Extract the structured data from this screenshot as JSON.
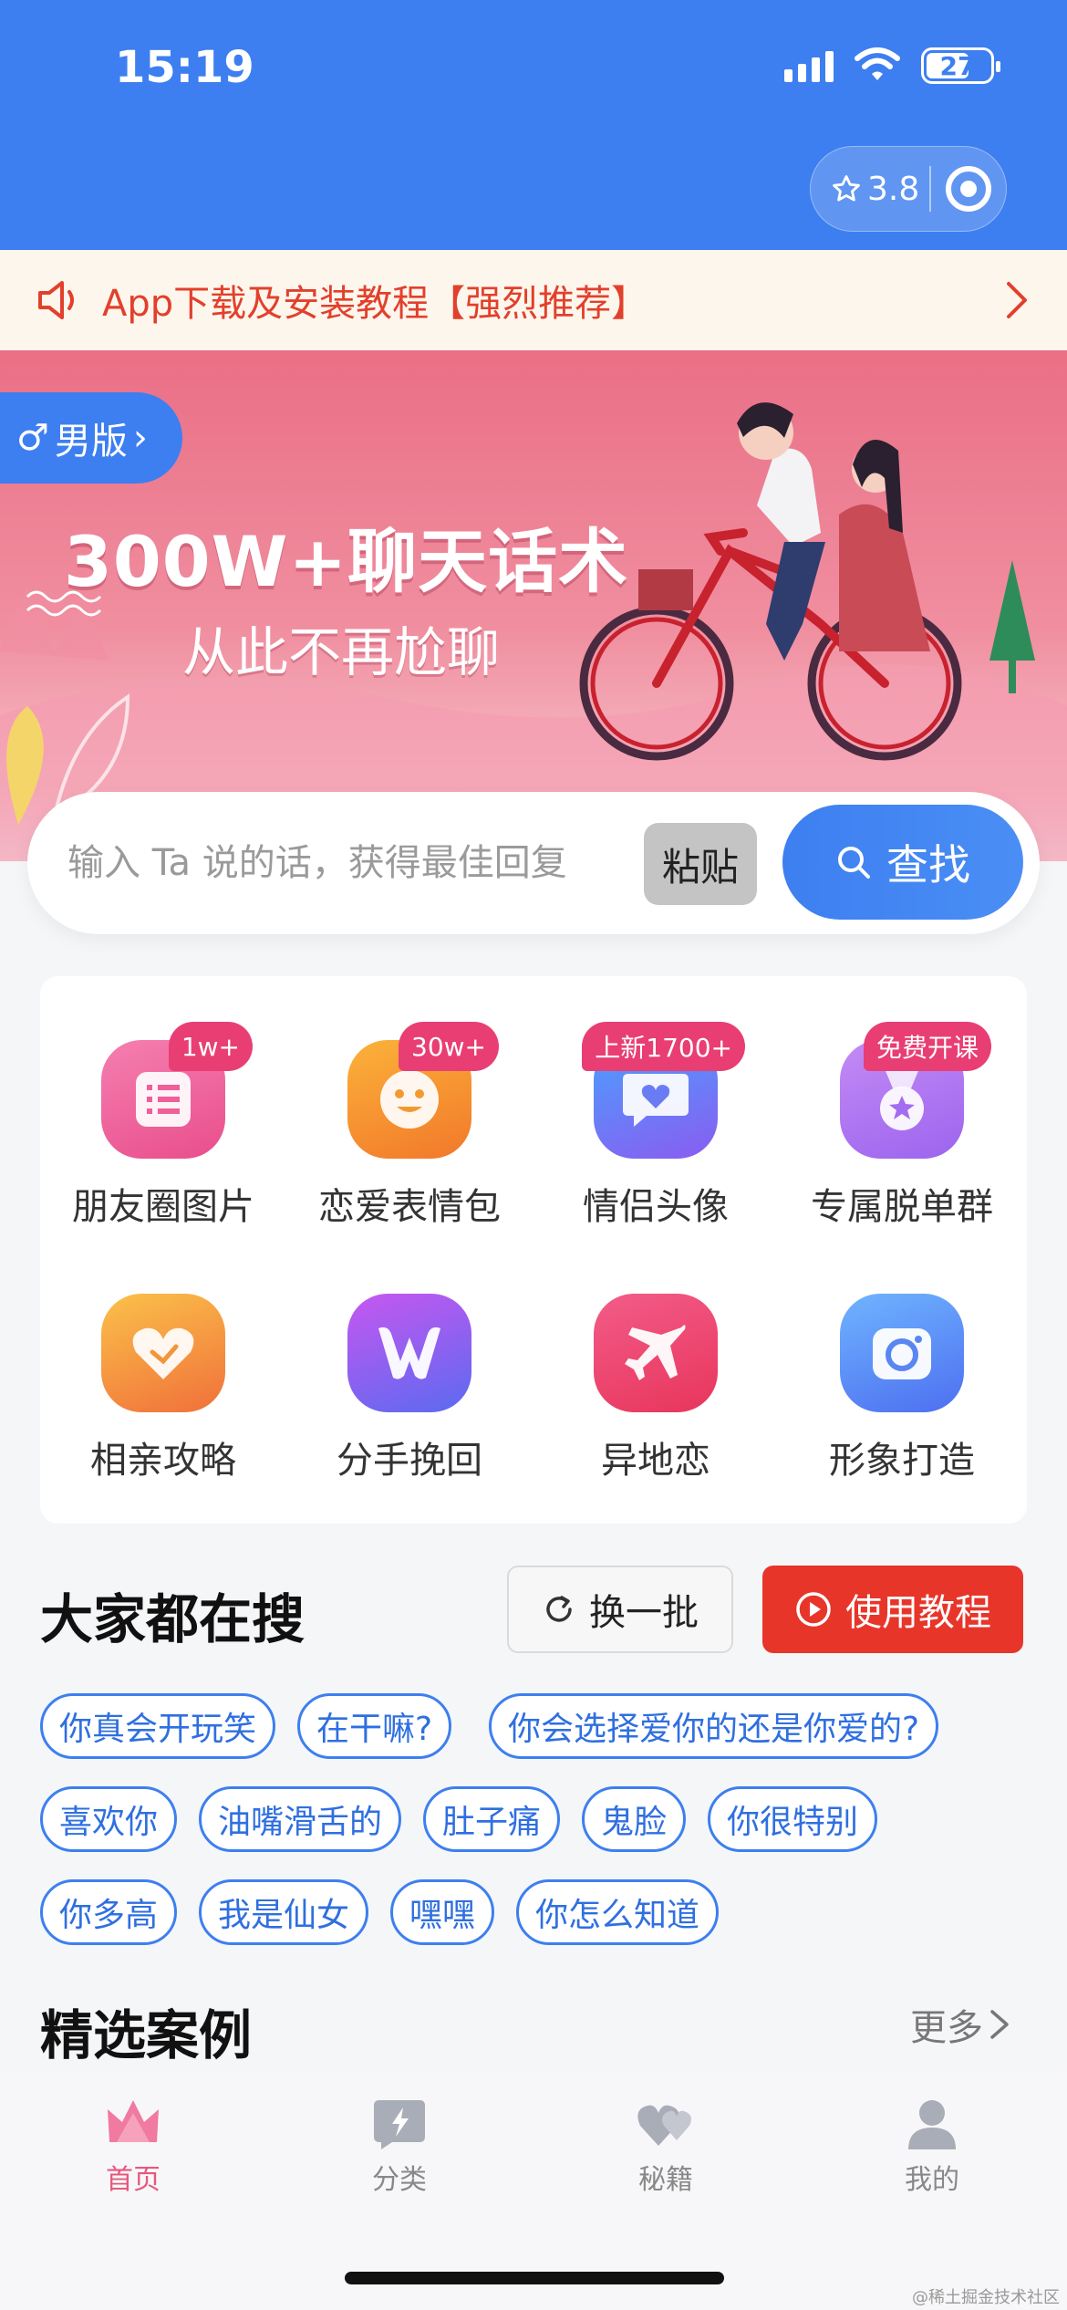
{
  "status_bar": {
    "time": "15:19",
    "battery": "27"
  },
  "capsule": {
    "rating": "3.8"
  },
  "notice": {
    "text": "App下载及安装教程【强烈推荐】"
  },
  "banner": {
    "gender_tab": "男版",
    "title": "300W+聊天话术",
    "subtitle": "从此不再尬聊"
  },
  "search": {
    "placeholder": "输入 Ta 说的话，获得最佳回复",
    "paste_label": "粘贴",
    "find_label": "查找"
  },
  "features": [
    {
      "label": "朋友圈图片",
      "badge": "1w+",
      "icon": "list-icon",
      "colors": [
        "#f57fb0",
        "#e94e8c"
      ]
    },
    {
      "label": "恋爱表情包",
      "badge": "30w+",
      "icon": "smile-icon",
      "colors": [
        "#fbb23a",
        "#f2782a"
      ]
    },
    {
      "label": "情侣头像",
      "badge": "上新1700+",
      "icon": "heart-chat-icon",
      "colors": [
        "#4aa0ff",
        "#8a5cf0"
      ]
    },
    {
      "label": "专属脱单群",
      "badge": "免费开课",
      "icon": "medal-icon",
      "colors": [
        "#c48bf5",
        "#9c64ee"
      ]
    },
    {
      "label": "相亲攻略",
      "badge": "",
      "icon": "heart-icon",
      "colors": [
        "#fbc14a",
        "#f0703a"
      ]
    },
    {
      "label": "分手挽回",
      "badge": "",
      "icon": "w-icon",
      "colors": [
        "#c757f0",
        "#5b6af0"
      ]
    },
    {
      "label": "异地恋",
      "badge": "",
      "icon": "plane-icon",
      "colors": [
        "#f25c88",
        "#e8355c"
      ]
    },
    {
      "label": "形象打造",
      "badge": "",
      "icon": "camera-icon",
      "colors": [
        "#6fb4ff",
        "#4d6ff0"
      ]
    }
  ],
  "hot": {
    "title": "大家都在搜",
    "refresh_label": "换一批",
    "tutorial_label": "使用教程",
    "tags": [
      "你真会开玩笑",
      "在干嘛?",
      "你会选择爱你的还是你爱的?",
      "喜欢你",
      "油嘴滑舌的",
      "肚子痛",
      "鬼脸",
      "你很特别",
      "你多高",
      "我是仙女",
      "嘿嘿",
      "你怎么知道"
    ]
  },
  "cases": {
    "title": "精选案例",
    "more_label": "更多"
  },
  "tabbar": {
    "items": [
      "首页",
      "分类",
      "秘籍",
      "我的"
    ]
  },
  "watermark": "@稀土掘金技术社区"
}
